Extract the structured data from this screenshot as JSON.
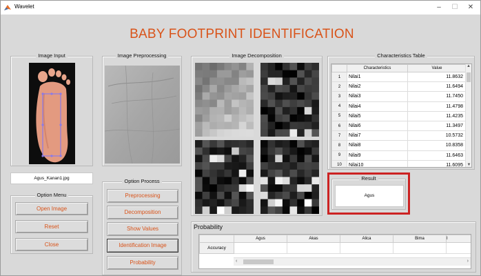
{
  "window": {
    "title": "Wavelet"
  },
  "app_title": "BABY FOOTPRINT IDENTIFICATION",
  "image_input": {
    "title": "Image Input",
    "filename": "Agus_Kanan1.jpg"
  },
  "image_preprocessing": {
    "title": "Image Preprocessing"
  },
  "image_decomposition": {
    "title": "Image Decomposition"
  },
  "option_menu": {
    "title": "Option Menu",
    "buttons": [
      "Open Image",
      "Reset",
      "Close"
    ]
  },
  "option_process": {
    "title": "Option Process",
    "buttons": [
      "Preprocessing",
      "Decomposition",
      "Show Values",
      "Identification Image",
      "Probability"
    ],
    "selected": "Identification Image"
  },
  "characteristics_table": {
    "title": "Characteristics Table",
    "columns": [
      "Characteristics",
      "Value"
    ],
    "rows": [
      {
        "n": "1",
        "name": "Nilai1",
        "value": "11.8632"
      },
      {
        "n": "2",
        "name": "Nilai2",
        "value": "11.6494"
      },
      {
        "n": "3",
        "name": "Nilai3",
        "value": "11.7450"
      },
      {
        "n": "4",
        "name": "Nilai4",
        "value": "11.4798"
      },
      {
        "n": "5",
        "name": "Nilai5",
        "value": "11.4235"
      },
      {
        "n": "6",
        "name": "Nilai6",
        "value": "11.3497"
      },
      {
        "n": "7",
        "name": "Nilai7",
        "value": "10.5732"
      },
      {
        "n": "8",
        "name": "Nilai8",
        "value": "10.8358"
      },
      {
        "n": "9",
        "name": "Nilai9",
        "value": "11.6463"
      },
      {
        "n": "10",
        "name": "Nilai10",
        "value": "11.6095"
      }
    ]
  },
  "result": {
    "title": "Result",
    "value": "Agus",
    "highlight_color": "#cc2222"
  },
  "probability": {
    "title": "Probability",
    "columns": [
      "Agus",
      "Akas",
      "Alica",
      "Bima",
      "I"
    ],
    "row_header": "Accuracy"
  },
  "colors": {
    "accent": "#d95319",
    "background": "#d9d9d9"
  }
}
